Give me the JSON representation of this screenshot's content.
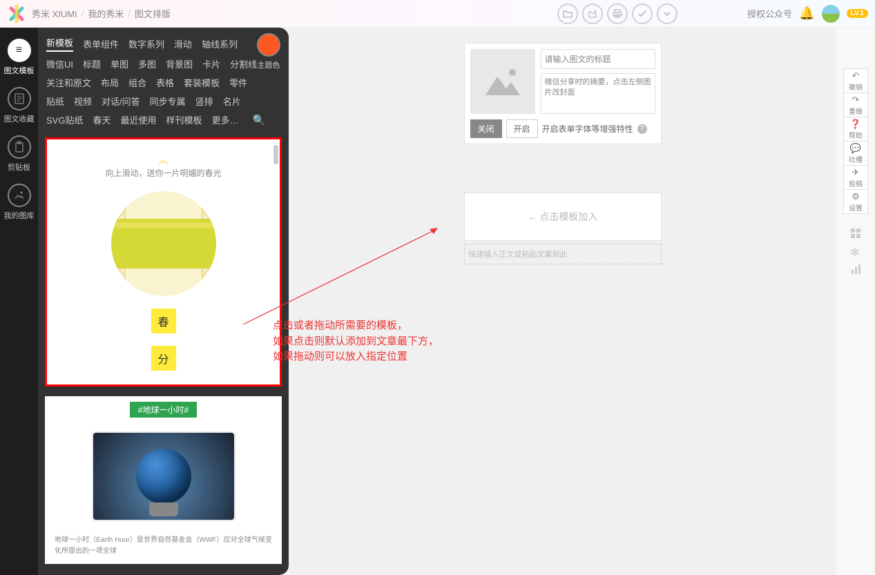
{
  "header": {
    "brand": "秀米 XIUMI",
    "crumb1": "我的秀米",
    "crumb2": "图文排版",
    "authorize": "授权公众号",
    "level": "LV.1"
  },
  "leftRail": {
    "items": [
      "图文模板",
      "图文收藏",
      "剪贴板",
      "我的图库"
    ]
  },
  "templateTabs": {
    "row1": [
      "新模板",
      "表单组件",
      "数字系列",
      "滑动",
      "轴线系列"
    ],
    "row2": [
      "微信UI",
      "标题",
      "单图",
      "多图",
      "背景图",
      "卡片",
      "分割线"
    ],
    "row3": [
      "关注和原文",
      "布局",
      "组合",
      "表格",
      "套装模板",
      "零件"
    ],
    "row4": [
      "贴纸",
      "视频",
      "对话/问答",
      "同步专属",
      "竖排",
      "名片"
    ],
    "row5": [
      "SVG贴纸",
      "春天",
      "最近使用",
      "样刊模板",
      "更多…"
    ],
    "themeLabel": "主题色"
  },
  "templates": {
    "springHint": "向上滑动，送你一片明媚的春光",
    "springChar1": "春",
    "springChar2": "分",
    "earthTag": "#地球一小时#",
    "earthDesc": "地球一小时（Earth Hour）是世界自然基金会（WWF）应对全球气候变化所提出的一项全球"
  },
  "canvas": {
    "titlePlaceholder": "请输入图文的标题",
    "summaryPlaceholder": "微信分享时的摘要，点击左侧图片改封面",
    "toggleOff": "关闭",
    "toggleOn": "开启",
    "enhanceLabel": "开启表单字体等增强特性",
    "dropHint": "← 点击模板加入",
    "pasteHint": "快速插入正文或粘贴文案到此"
  },
  "rightRail": {
    "items": [
      {
        "icon": "↶",
        "label": "撤销"
      },
      {
        "icon": "↷",
        "label": "重做"
      },
      {
        "icon": "❓",
        "label": "帮助"
      },
      {
        "icon": "💬",
        "label": "吐槽"
      },
      {
        "icon": "✈",
        "label": "投稿"
      },
      {
        "icon": "⚙",
        "label": "设置"
      }
    ]
  },
  "annotation": {
    "line1": "点击或者拖动所需要的模板，",
    "line2": "如果点击则默认添加到文章最下方，",
    "line3": "如果拖动则可以放入指定位置"
  }
}
